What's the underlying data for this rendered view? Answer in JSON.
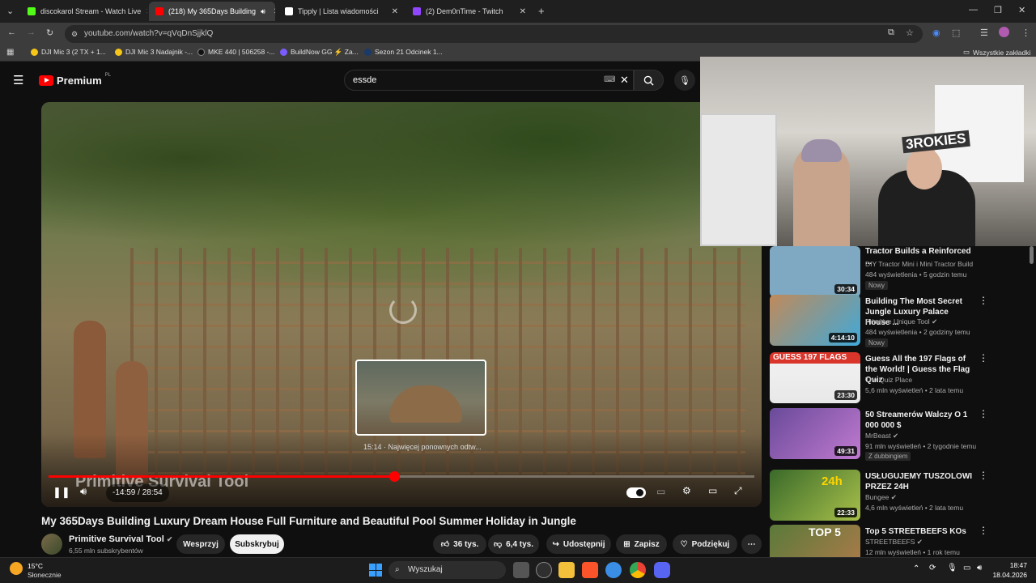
{
  "browser": {
    "tabs": [
      {
        "title": "discokarol Stream - Watch Live",
        "favicon_color": "#53fc18"
      },
      {
        "title": "(218) My 365Days Building",
        "favicon_color": "#ff0000"
      },
      {
        "title": "Tipply | Lista wiadomości",
        "favicon_color": "#ffffff"
      },
      {
        "title": "(2) Dem0nTime - Twitch",
        "favicon_color": "#9146ff"
      }
    ],
    "url": "youtube.com/watch?v=qVqDnSjjklQ",
    "bookmarks": [
      {
        "label": "DJI Mic 3 (2 TX + 1...",
        "color": "#f5c518"
      },
      {
        "label": "DJI Mic 3 Nadajnik -...",
        "color": "#f5c518"
      },
      {
        "label": "MKE 440 | 506258 -...",
        "color": "#222222"
      },
      {
        "label": "BuildNow GG ⚡ Za...",
        "color": "#7b5cff"
      },
      {
        "label": "Sezon 21 Odcinek 1...",
        "color": "#1a3a6a"
      }
    ],
    "all_bookmarks": "Wszystkie zakładki"
  },
  "youtube": {
    "logo": "Premium",
    "logo_region": "PL",
    "search_value": "essde",
    "player": {
      "watermark": "Primitive Survival Tool",
      "current_time": "-14:59",
      "duration": "28:54",
      "progress_fraction": 0.49,
      "preview_label": "15:14 · Najwięcej ponownych odtw..."
    },
    "video_title": "My 365Days Building Luxury Dream House Full Furniture and Beautiful Pool Summer Holiday in Jungle",
    "channel": {
      "name": "Primitive Survival Tool",
      "subscribers": "6,55 mln subskrybentów",
      "support_label": "Wesprzyj",
      "subscribe_label": "Subskrybuj"
    },
    "actions": {
      "likes": "36 tys.",
      "dislikes": "6,4 tys.",
      "share": "Udostępnij",
      "save": "Zapisz",
      "thanks": "Podziękuj"
    },
    "recommendations": [
      {
        "title": "Tractor Builds a Reinforced ...",
        "channel": "DIY Tractor Mini i Mini Tractor Build",
        "meta": "484 wyświetlenia • 5 godzin temu",
        "badge": "Nowy",
        "duration": "30:34",
        "thumb": "#7fa9c2"
      },
      {
        "title": "Building The Most Secret Jungle Luxury Palace House ...",
        "channel": "Primitive Unique Tool",
        "meta": "484 wyświetlenia • 2 godziny temu",
        "badge": "Nowy",
        "duration": "4:14:10",
        "thumb": "#c08a5a"
      },
      {
        "title": "Guess All the 197 Flags of the World! | Guess the Flag Quiz",
        "channel": "The Quiz Place",
        "meta": "5,6 mln wyświetleń • 2 lata temu",
        "badge": "",
        "duration": "23:30",
        "thumb": "#d9352b",
        "overlay": "GUESS 197 FLAGS"
      },
      {
        "title": "50 Streamerów Walczy O 1 000 000 $",
        "channel": "MrBeast",
        "meta": "91 mln wyświetleń • 2 tygodnie temu",
        "badge": "Z dubbingiem",
        "duration": "49:31",
        "thumb": "#6a4a9a"
      },
      {
        "title": "USŁUGUJEMY TUSZOLOWI PRZEZ 24H",
        "channel": "Bungee",
        "meta": "4,6 mln wyświetleń • 2 lata temu",
        "badge": "",
        "duration": "22:33",
        "thumb": "#3a6a2a",
        "overlay": "24h"
      },
      {
        "title": "Top 5 STREETBEEFS KOs",
        "channel": "STREETBEEFS",
        "meta": "12 mln wyświetleń • 1 rok temu",
        "badge": "",
        "duration": "",
        "thumb": "#5a7a3a",
        "overlay": "TOP 5"
      }
    ]
  },
  "webcam": {
    "sign_text": "3ROKIES"
  },
  "taskbar": {
    "temperature": "15°C",
    "weather": "Słonecznie",
    "search_placeholder": "Wyszukaj",
    "time": "18:47",
    "date": "18.04.2026"
  }
}
